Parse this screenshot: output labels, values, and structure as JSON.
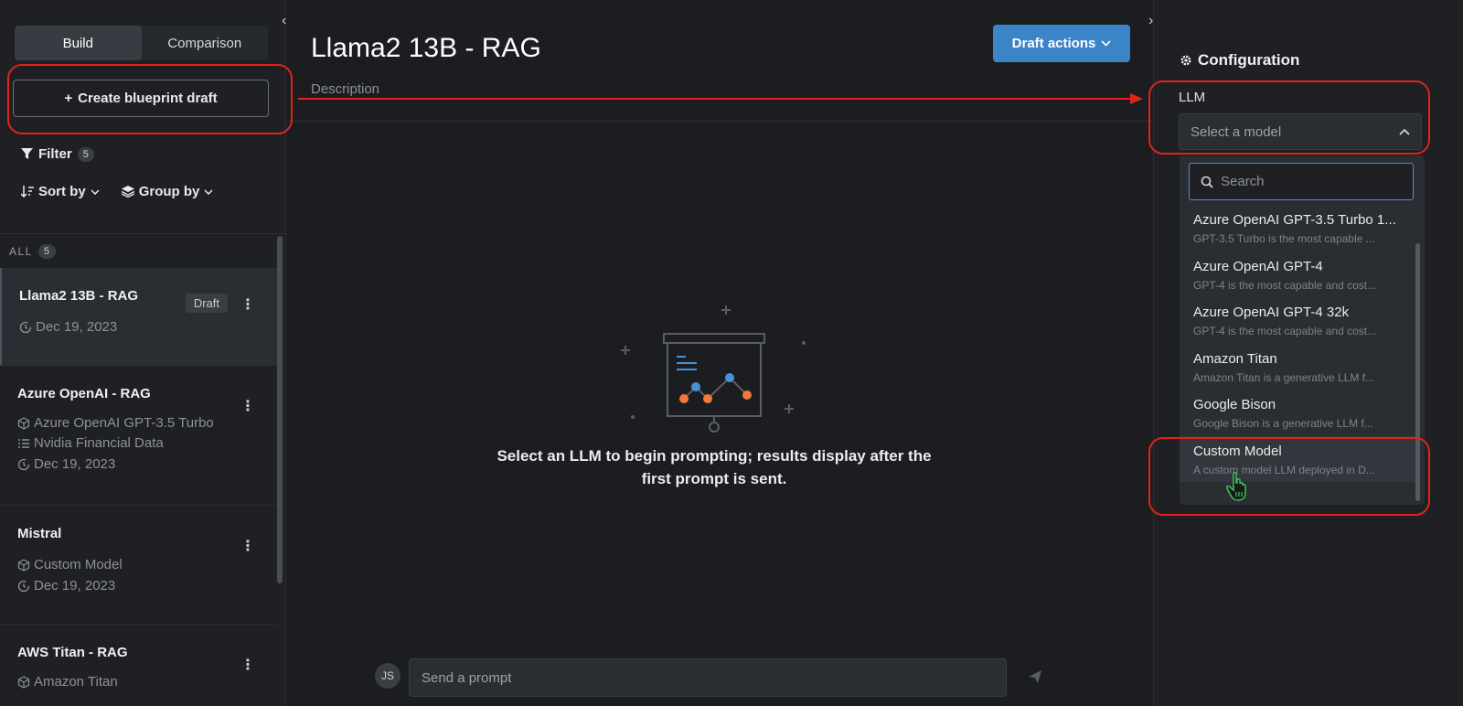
{
  "sidebar": {
    "tabs": [
      {
        "label": "Build",
        "active": true
      },
      {
        "label": "Comparison",
        "active": false
      }
    ],
    "create_label": "Create blueprint draft",
    "filter_label": "Filter",
    "filter_count": "5",
    "sort_label": "Sort by",
    "group_label": "Group by",
    "section_label": "ALL",
    "section_count": "5",
    "cards": [
      {
        "title": "Llama2 13B - RAG",
        "badge": "Draft",
        "lines": [
          {
            "icon": "clock-icon",
            "text": "Dec 19, 2023"
          }
        ]
      },
      {
        "title": "Azure OpenAI - RAG",
        "lines": [
          {
            "icon": "cube-icon",
            "text": "Azure OpenAI GPT-3.5 Turbo"
          },
          {
            "icon": "list-icon",
            "text": "Nvidia Financial Data"
          },
          {
            "icon": "clock-icon",
            "text": "Dec 19, 2023"
          }
        ]
      },
      {
        "title": "Mistral",
        "lines": [
          {
            "icon": "cube-icon",
            "text": "Custom Model"
          },
          {
            "icon": "clock-icon",
            "text": "Dec 19, 2023"
          }
        ]
      },
      {
        "title": "AWS Titan - RAG",
        "lines": [
          {
            "icon": "cube-icon",
            "text": "Amazon Titan"
          }
        ]
      }
    ]
  },
  "main": {
    "title": "Llama2 13B - RAG",
    "description": "Description",
    "draft_actions": "Draft actions",
    "empty_text": "Select an LLM to begin prompting; results display after the first prompt is sent.",
    "avatar": "JS",
    "prompt_placeholder": "Send a prompt"
  },
  "config": {
    "title": "Configuration",
    "llm_label": "LLM",
    "select_placeholder": "Select a model",
    "search_placeholder": "Search",
    "options": [
      {
        "name": "Azure OpenAI GPT-3.5 Turbo 1...",
        "desc": "GPT-3.5 Turbo is the most capable ..."
      },
      {
        "name": "Azure OpenAI GPT-4",
        "desc": "GPT-4 is the most capable and cost..."
      },
      {
        "name": "Azure OpenAI GPT-4 32k",
        "desc": "GPT-4 is the most capable and cost..."
      },
      {
        "name": "Amazon Titan",
        "desc": "Amazon Titan is a generative LLM f..."
      },
      {
        "name": "Google Bison",
        "desc": "Google Bison is a generative LLM f..."
      },
      {
        "name": "Custom Model",
        "desc": "A custom model LLM deployed in D..."
      }
    ]
  },
  "colors": {
    "accent_button": "#3c84c8",
    "annotation": "#e02418",
    "chart_blue": "#4a90d9",
    "chart_orange": "#f07a3a"
  }
}
